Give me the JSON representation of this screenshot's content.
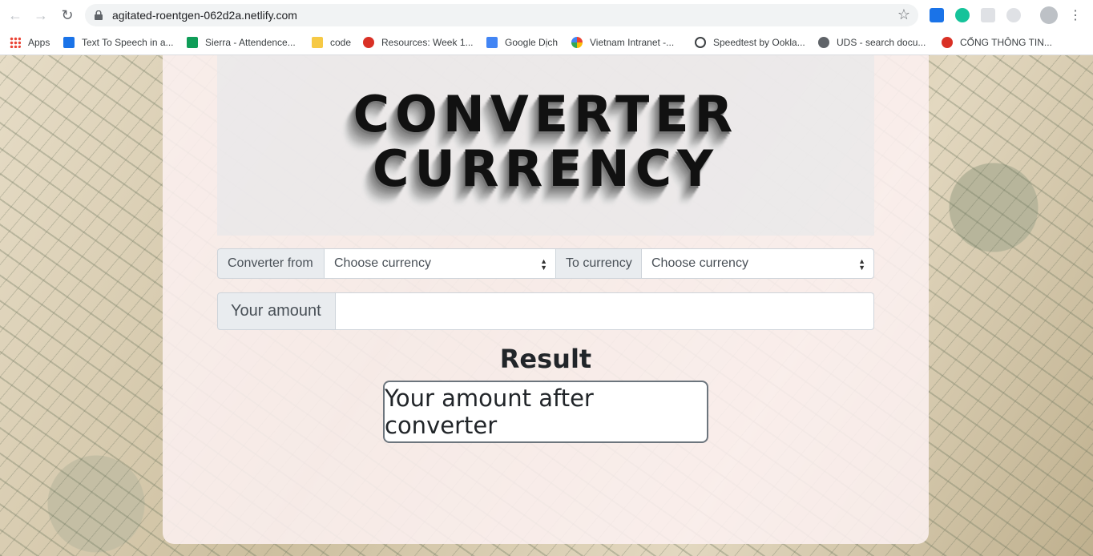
{
  "browser": {
    "url": "agitated-roentgen-062d2a.netlify.com",
    "bookmarks": [
      {
        "label": "Apps",
        "icon": "apps-grid-icon",
        "color": "#ea4335"
      },
      {
        "label": "Text To Speech in a...",
        "icon": "speech-icon",
        "color": "#1a73e8"
      },
      {
        "label": "Sierra - Attendence...",
        "icon": "sheets-icon",
        "color": "#0f9d58"
      },
      {
        "label": "code",
        "icon": "folder-icon",
        "color": "#f6c945"
      },
      {
        "label": "Resources: Week 1...",
        "icon": "resources-icon",
        "color": "#d93025"
      },
      {
        "label": "Google Dịch",
        "icon": "translate-icon",
        "color": "#4285f4"
      },
      {
        "label": "Vietnam Intranet -...",
        "icon": "google-icon",
        "color": "#ea4335"
      },
      {
        "label": "Speedtest by Ookla...",
        "icon": "speedometer-icon",
        "color": "#3c4043"
      },
      {
        "label": "UDS - search docu...",
        "icon": "globe-icon",
        "color": "#5f6368"
      },
      {
        "label": "CỔNG THÔNG TIN...",
        "icon": "emblem-icon",
        "color": "#d93025"
      }
    ]
  },
  "page": {
    "title_line1": "CONVERTER",
    "title_line2": "CURRENCY",
    "from_label": "Converter from",
    "from_placeholder": "Choose currency",
    "to_label": "To currency",
    "to_placeholder": "Choose currency",
    "amount_label": "Your amount",
    "amount_value": "",
    "result_heading": "Result",
    "result_text": "Your amount after converter"
  }
}
